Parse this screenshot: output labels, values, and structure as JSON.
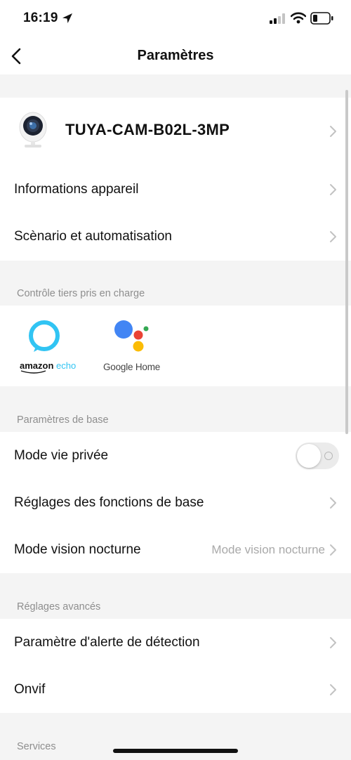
{
  "status": {
    "time": "16:19"
  },
  "nav": {
    "title": "Paramètres"
  },
  "device": {
    "name": "TUYA-CAM-B02L-3MP"
  },
  "menu_top": [
    {
      "label": "Informations appareil"
    },
    {
      "label": "Scènario et automatisation"
    }
  ],
  "third_party": {
    "header": "Contrôle tiers pris en charge",
    "amazon": {
      "brand": "amazon",
      "product": "echo"
    },
    "google": {
      "label": "Google Home"
    }
  },
  "basic": {
    "header": "Paramètres de base",
    "privacy_label": "Mode vie privée",
    "privacy_on": false,
    "functions_label": "Réglages des fonctions de base",
    "night_label": "Mode vision nocturne",
    "night_value": "Mode vision nocturne"
  },
  "advanced": {
    "header": "Réglages avancés",
    "detection_label": "Paramètre d'alerte de détection",
    "onvif_label": "Onvif"
  },
  "services": {
    "header": "Services"
  },
  "colors": {
    "alexa": "#31c4f3",
    "google_blue": "#4285f4",
    "google_red": "#ea4335",
    "google_yellow": "#fbbc05",
    "google_green": "#34a853"
  }
}
